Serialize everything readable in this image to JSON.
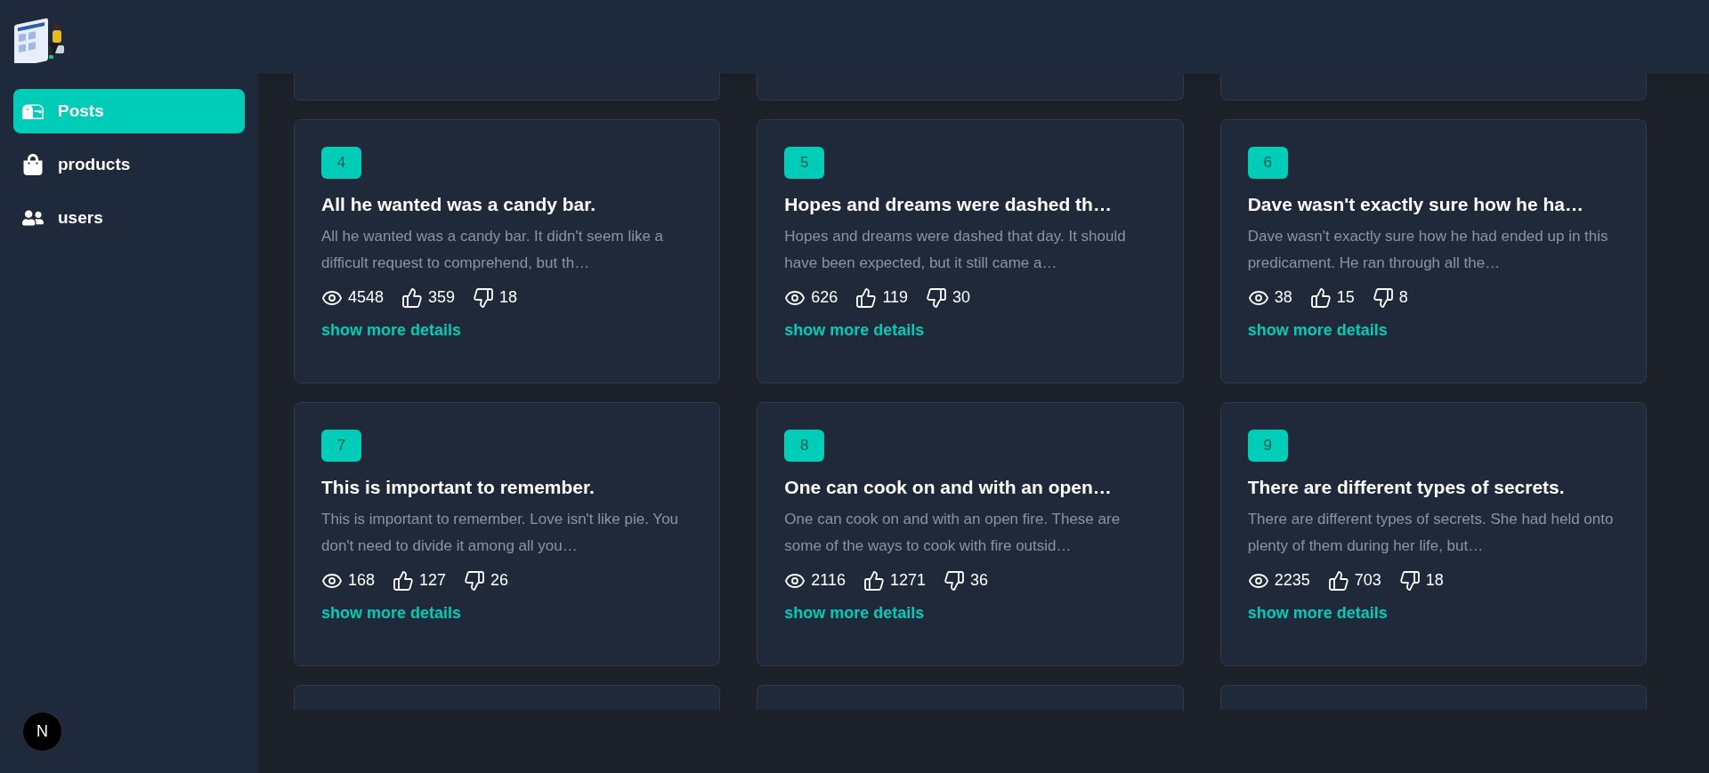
{
  "sidebar": {
    "items": [
      {
        "label": "Posts",
        "kind": "mailbox",
        "selected": true
      },
      {
        "label": "products",
        "kind": "bag",
        "selected": false
      },
      {
        "label": "users",
        "kind": "users",
        "selected": false
      }
    ],
    "profile": {
      "initial": "N"
    }
  },
  "posts": [
    {
      "id": "4",
      "title": "All he wanted was a candy bar.",
      "body": "All he wanted was a candy bar. It didn't seem like a difficult request to comprehend, but th…",
      "views": "4548",
      "likes": "359",
      "dislikes": "18",
      "link": "show more details"
    },
    {
      "id": "5",
      "title": "Hopes and dreams were dashed th…",
      "body": "Hopes and dreams were dashed that day. It should have been expected, but it still came a…",
      "views": "626",
      "likes": "119",
      "dislikes": "30",
      "link": "show more details"
    },
    {
      "id": "6",
      "title": "Dave wasn't exactly sure how he ha…",
      "body": "Dave wasn't exactly sure how he had ended up in this predicament. He ran through all the…",
      "views": "38",
      "likes": "15",
      "dislikes": "8",
      "link": "show more details"
    },
    {
      "id": "7",
      "title": "This is important to remember.",
      "body": "This is important to remember. Love isn't like pie. You don't need to divide it among all you…",
      "views": "168",
      "likes": "127",
      "dislikes": "26",
      "link": "show more details"
    },
    {
      "id": "8",
      "title": "One can cook on and with an open…",
      "body": "One can cook on and with an open fire. These are some of the ways to cook with fire outsid…",
      "views": "2116",
      "likes": "1271",
      "dislikes": "36",
      "link": "show more details"
    },
    {
      "id": "9",
      "title": "There are different types of secrets.",
      "body": "There are different types of secrets. She had held onto plenty of them during her life, but…",
      "views": "2235",
      "likes": "703",
      "dislikes": "18",
      "link": "show more details"
    }
  ]
}
